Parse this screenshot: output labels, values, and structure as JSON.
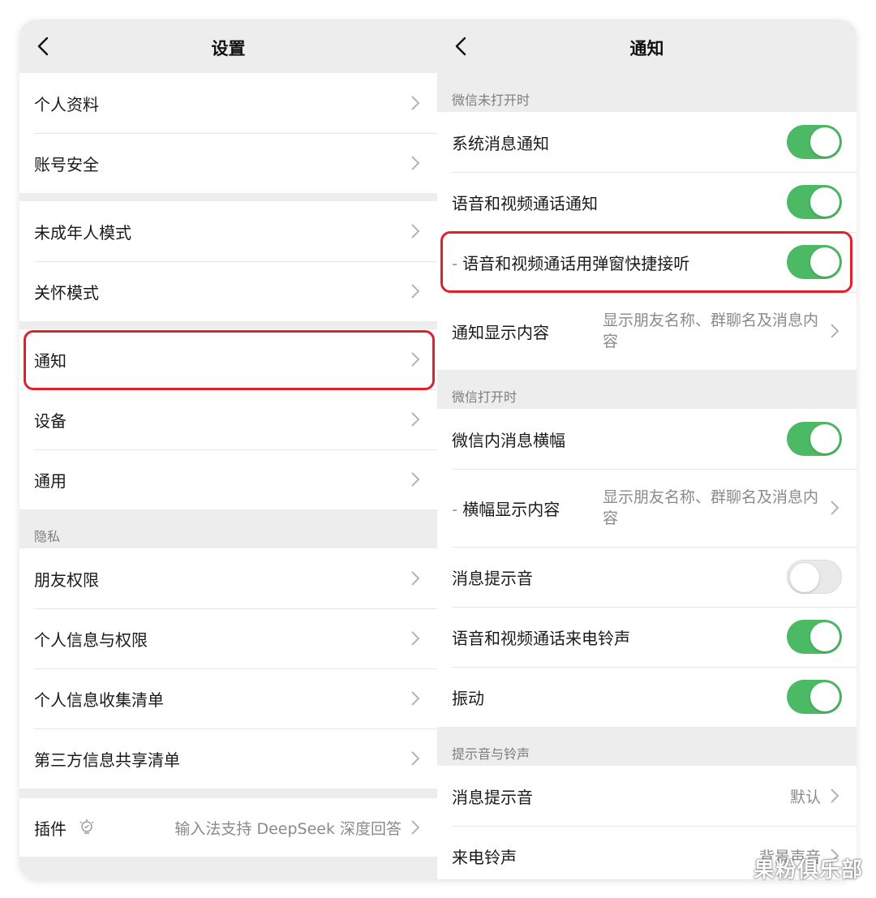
{
  "left": {
    "title": "设置",
    "groups": [
      [
        "个人资料",
        "账号安全"
      ],
      [
        "未成年人模式",
        "关怀模式"
      ],
      [
        "通知",
        "设备",
        "通用"
      ]
    ],
    "privacy_header": "隐私",
    "privacy_items": [
      "朋友权限",
      "个人信息与权限",
      "个人信息收集清单",
      "第三方信息共享清单"
    ],
    "plugin": {
      "label": "插件",
      "value": "输入法支持 DeepSeek 深度回答"
    }
  },
  "right": {
    "title": "通知",
    "section1_header": "微信未打开时",
    "section1": {
      "system_notify": "系统消息通知",
      "call_notify": "语音和视频通话通知",
      "call_popup": "语音和视频通话用弹窗快捷接听",
      "display_label": "通知显示内容",
      "display_value": "显示朋友名称、群聊名及消息内容"
    },
    "section2_header": "微信打开时",
    "section2": {
      "banner": "微信内消息横幅",
      "banner_display_label": "横幅显示内容",
      "banner_display_value": "显示朋友名称、群聊名及消息内容",
      "sound": "消息提示音",
      "ringtone_toggle": "语音和视频通话来电铃声",
      "vibrate": "振动"
    },
    "section3_header": "提示音与铃声",
    "section3": {
      "msg_sound_label": "消息提示音",
      "msg_sound_value": "默认",
      "ring_label": "来电铃声",
      "ring_value": "背景声音"
    },
    "toggles": {
      "system_notify": true,
      "call_notify": true,
      "call_popup": true,
      "banner": true,
      "sound": false,
      "ringtone": true,
      "vibrate": true
    }
  },
  "watermark": "果粉俱乐部",
  "colors": {
    "toggle_on": "#4cb964",
    "highlight": "#e0202a",
    "background": "#ededed"
  },
  "icons": [
    "back-arrow-icon",
    "chevron-right-icon",
    "plugin-bulb-icon"
  ]
}
